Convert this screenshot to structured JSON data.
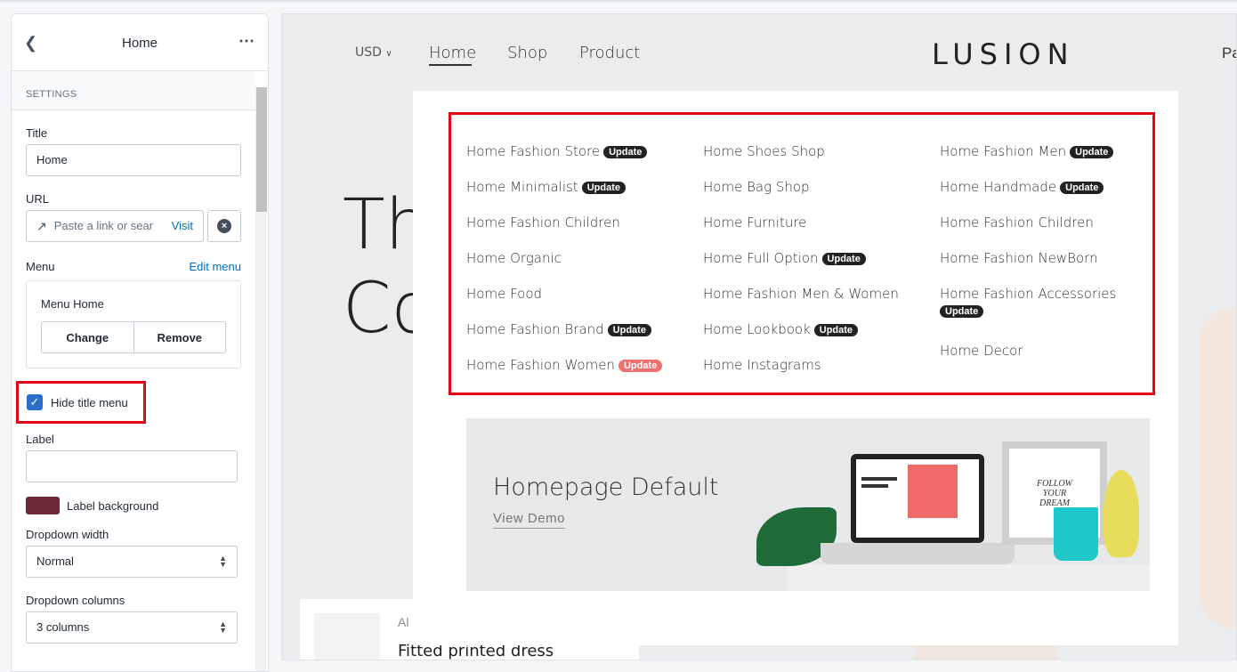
{
  "sidebar": {
    "header_title": "Home",
    "section_title": "SETTINGS",
    "title_label": "Title",
    "title_value": "Home",
    "url_label": "URL",
    "url_placeholder": "Paste a link or sear",
    "url_visit": "Visit",
    "menu_label": "Menu",
    "menu_edit": "Edit menu",
    "menu_name": "Menu Home",
    "change_button": "Change",
    "remove_button": "Remove",
    "hide_title_menu": "Hide title menu",
    "hide_title_checked": true,
    "label_label": "Label",
    "label_value": "",
    "label_bg_label": "Label background",
    "label_bg_color": "#6b2a34",
    "dropdown_width_label": "Dropdown width",
    "dropdown_width_value": "Normal",
    "dropdown_columns_label": "Dropdown columns",
    "dropdown_columns_value": "3 columns"
  },
  "preview": {
    "currency": "USD",
    "nav": [
      "Home",
      "Shop",
      "Product"
    ],
    "logo": "LUSION",
    "nav_right": "Pa",
    "hero_line1": "Th",
    "hero_line2": "Co",
    "product_brand": "Al",
    "product_name": "Fitted printed dress",
    "menu_columns": [
      [
        {
          "label": "Home Fashion Store",
          "badge": "Update"
        },
        {
          "label": "Home Minimalist",
          "badge": "Update"
        },
        {
          "label": "Home Fashion Children",
          "badge": ""
        },
        {
          "label": "Home Organic",
          "badge": ""
        },
        {
          "label": "Home Food",
          "badge": ""
        },
        {
          "label": "Home Fashion Brand",
          "badge": "Update"
        },
        {
          "label": "Home Fashion Women",
          "badge": "Update",
          "badge_color": "#f06f6f"
        }
      ],
      [
        {
          "label": "Home Shoes Shop",
          "badge": ""
        },
        {
          "label": "Home Bag Shop",
          "badge": ""
        },
        {
          "label": "Home Furniture",
          "badge": ""
        },
        {
          "label": "Home Full Option",
          "badge": "Update"
        },
        {
          "label": "Home Fashion Men & Women",
          "badge": ""
        },
        {
          "label": "Home Lookbook",
          "badge": "Update"
        },
        {
          "label": "Home Instagrams",
          "badge": ""
        }
      ],
      [
        {
          "label": "Home Fashion Men",
          "badge": "Update"
        },
        {
          "label": "Home Handmade",
          "badge": "Update"
        },
        {
          "label": "Home Fashion Children",
          "badge": ""
        },
        {
          "label": "Home Fashion NewBorn",
          "badge": ""
        },
        {
          "label": "Home Fashion Accessories",
          "badge": "Update"
        },
        {
          "label": "Home Decor",
          "badge": ""
        }
      ]
    ],
    "banner_title": "Homepage Default",
    "banner_link": "View Demo",
    "frame_text": "FOLLOW YOUR DREAM"
  },
  "colors": {
    "accent": "#2c6ecb",
    "highlight": "#e30613",
    "badge_dark": "#222222",
    "badge_hot": "#f06f6f"
  }
}
